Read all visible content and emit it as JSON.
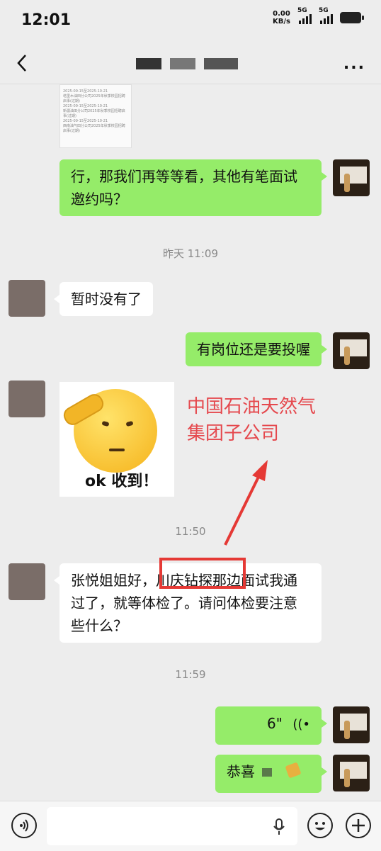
{
  "status_bar": {
    "time": "12:01",
    "net_speed_value": "0.00",
    "net_speed_unit": "KB/s",
    "sim1_label": "5G",
    "sim2_label": "5G"
  },
  "header": {
    "more_label": "..."
  },
  "screenshot_preview": {
    "lines": [
      "2025-09-15至2025-10-21",
      "塔里木油田分公司2025年秋季校园招聘启事(过期)",
      "2025-09-15至2025-10-21",
      "新疆油田分公司2025年秋季校园招聘启事(过期)",
      "2025-09-15至2025-10-21",
      "西南油气田分公司2025年秋季校园招聘启事(过期)"
    ]
  },
  "messages": {
    "m1": "行，那我们再等等看，其他有笔面试邀约吗？",
    "ts1": "昨天 11:09",
    "m2": "暂时没有了",
    "m3": "有岗位还是要投喔",
    "sticker_text": "ok 收到！",
    "ts2": "11:50",
    "m4": "张悦姐姐好，川庆钻探那边面试我通过了，就等体检了。请问体检要注意些什么？",
    "ts3": "11:59",
    "voice_duration": "6\"",
    "m5": "恭喜"
  },
  "annotation": {
    "line1": "中国石油天然气",
    "line2": "集团子公司",
    "color": "#e5484d"
  },
  "colors": {
    "my_bubble": "#95ec69",
    "other_bubble": "#ffffff",
    "background": "#ededed"
  }
}
